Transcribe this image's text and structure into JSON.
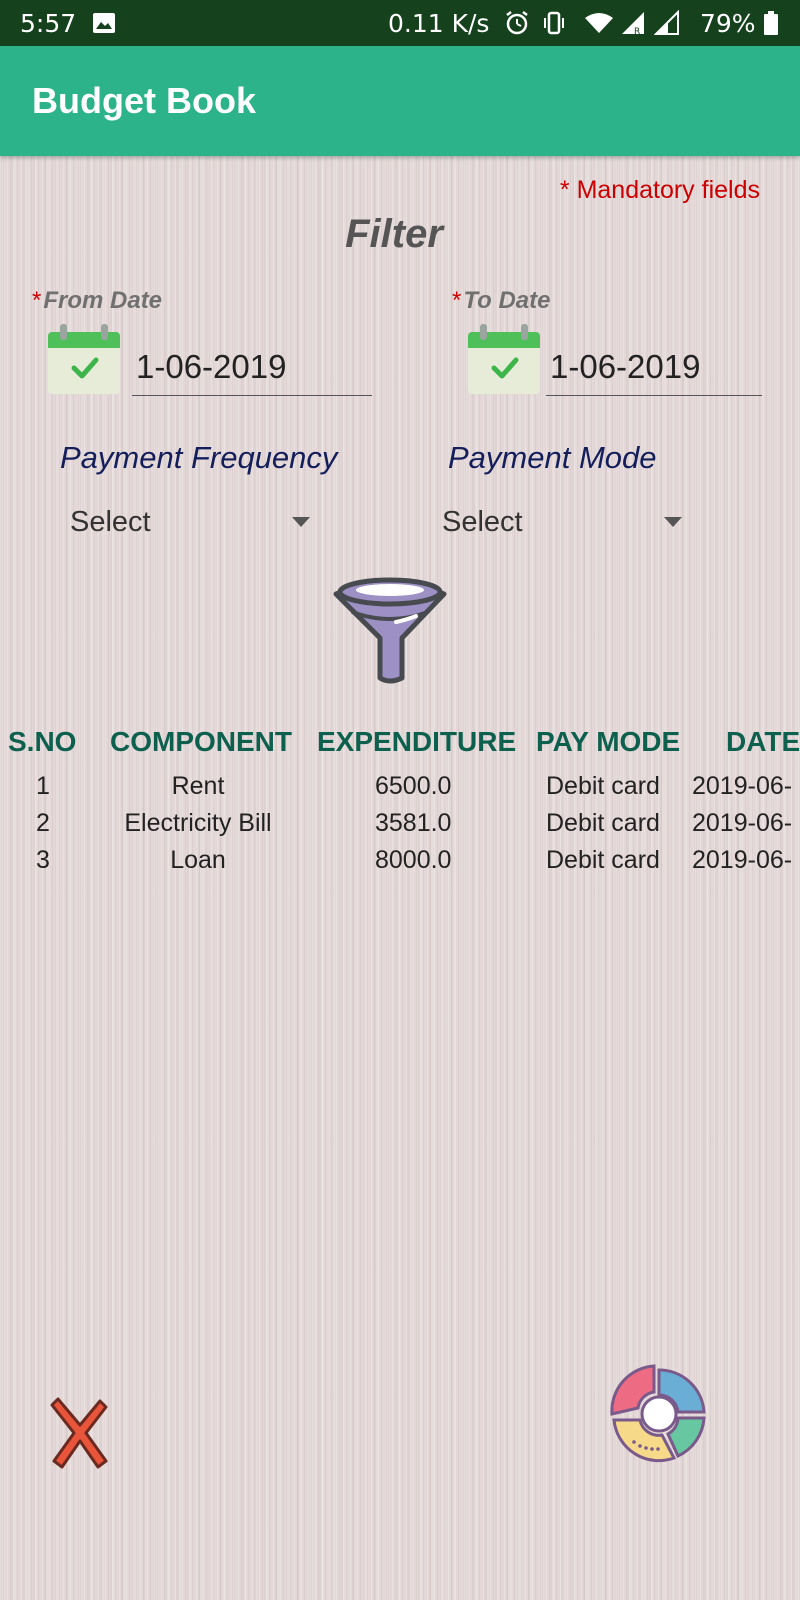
{
  "status_bar": {
    "time": "5:57",
    "net_speed": "0.11 K/s",
    "battery": "79%"
  },
  "app_bar": {
    "title": "Budget Book"
  },
  "form": {
    "mandatory_note": "* Mandatory fields",
    "title": "Filter",
    "from_date": {
      "label": "From Date",
      "value": "1-06-2019"
    },
    "to_date": {
      "label": "To Date",
      "value": "1-06-2019"
    },
    "required_marker": "*",
    "payment_frequency": {
      "label": "Payment Frequency",
      "selected": "Select"
    },
    "payment_mode": {
      "label": "Payment Mode",
      "selected": "Select"
    }
  },
  "table": {
    "headers": {
      "sno": "S.NO",
      "component": "COMPONENT",
      "expenditure": "EXPENDITURE",
      "pay_mode": "PAY MODE",
      "date": "DATE"
    },
    "rows": [
      {
        "sno": "1",
        "component": "Rent",
        "expenditure": "6500.0",
        "pay_mode": "Debit card",
        "date": "2019-06-"
      },
      {
        "sno": "2",
        "component": "Electricity Bill",
        "expenditure": "3581.0",
        "pay_mode": "Debit card",
        "date": "2019-06-"
      },
      {
        "sno": "3",
        "component": "Loan",
        "expenditure": "8000.0",
        "pay_mode": "Debit card",
        "date": "2019-06-"
      }
    ]
  },
  "icons": {
    "calendar": "calendar-check-icon",
    "filter": "funnel-icon",
    "close": "close-x-icon",
    "chart": "donut-chart-icon"
  },
  "colors": {
    "app_bar": "#2db38a",
    "status_bar": "#15421c",
    "header_text": "#0d5f4e",
    "mandatory": "#cc0000",
    "dropdown_label": "#141e5a"
  }
}
